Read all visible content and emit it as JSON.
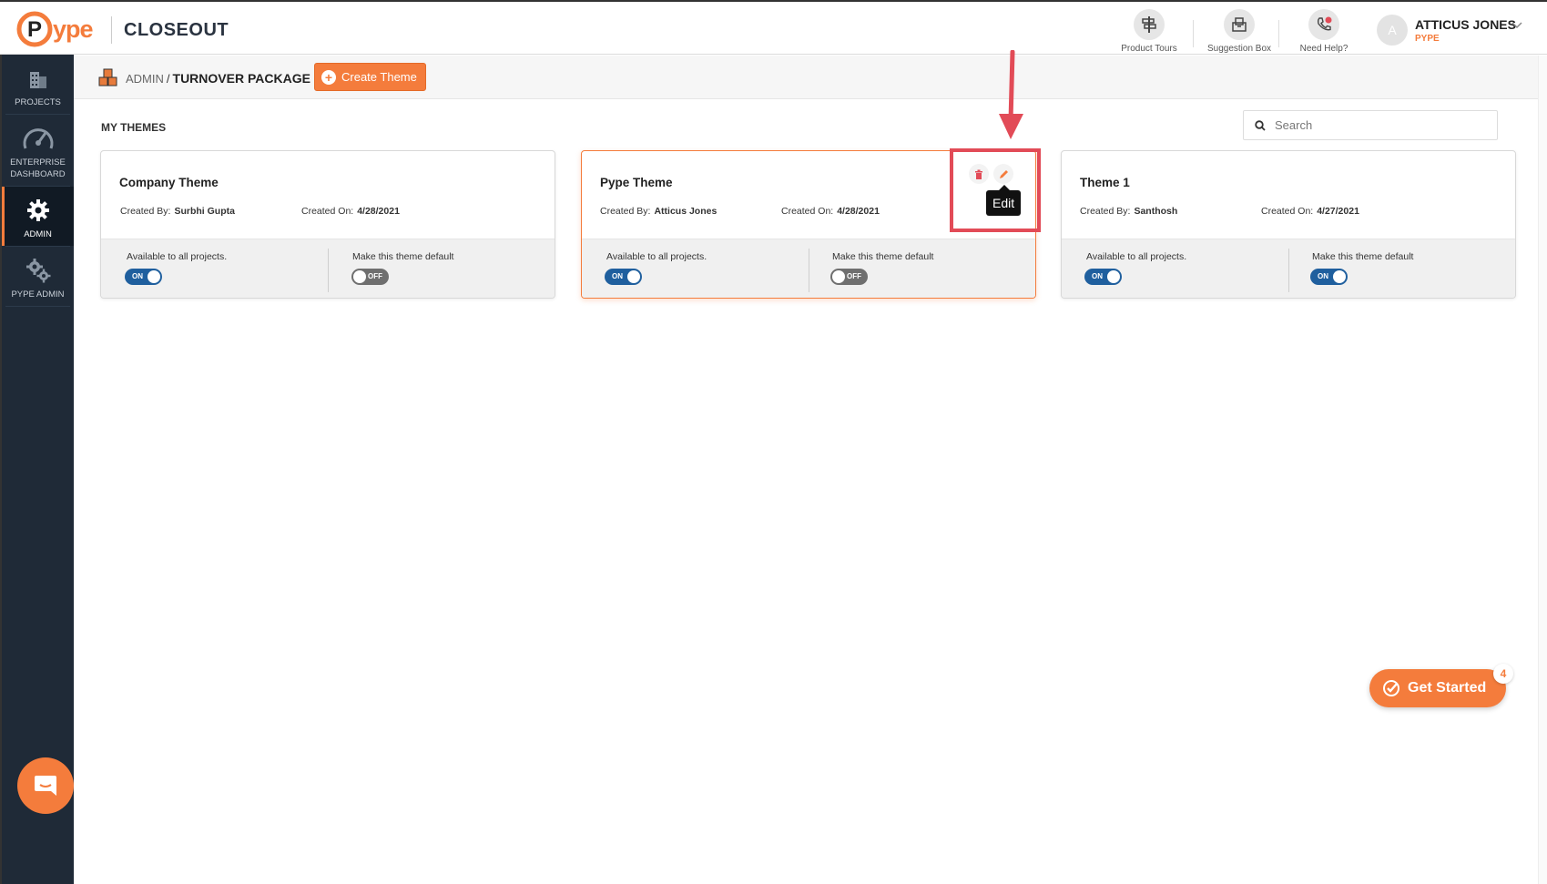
{
  "app": {
    "logo_text": "ype",
    "title": "CLOSEOUT"
  },
  "header": {
    "product_tours": "Product Tours",
    "suggestion_box": "Suggestion Box",
    "need_help": "Need Help?",
    "user_initial": "A",
    "user_name": "ATTICUS JONES",
    "user_org": "PYPE"
  },
  "sidebar": {
    "items": [
      {
        "label": "PROJECTS"
      },
      {
        "label": "ENTERPRISE DASHBOARD"
      },
      {
        "label": "ADMIN"
      },
      {
        "label": "PYPE ADMIN"
      }
    ]
  },
  "breadcrumb": {
    "parent": "ADMIN",
    "separator": "/",
    "current": "TURNOVER PACKAGE"
  },
  "toolbar": {
    "create_label": "Create Theme"
  },
  "themes_section": {
    "title": "MY THEMES"
  },
  "search": {
    "placeholder": "Search"
  },
  "theme_labels": {
    "created_by": "Created By:",
    "created_on": "Created On:",
    "available": "Available to all projects.",
    "default": "Make this theme default"
  },
  "themes": [
    {
      "name": "Company Theme",
      "created_by": "Surbhi Gupta",
      "created_on": "4/28/2021",
      "available": "ON",
      "default": "OFF"
    },
    {
      "name": "Pype Theme",
      "created_by": "Atticus Jones",
      "created_on": "4/28/2021",
      "available": "ON",
      "default": "OFF"
    },
    {
      "name": "Theme 1",
      "created_by": "Santhosh",
      "created_on": "4/27/2021",
      "available": "ON",
      "default": "ON"
    }
  ],
  "tooltip": {
    "edit": "Edit"
  },
  "get_started": {
    "label": "Get Started",
    "badge": "4"
  },
  "colors": {
    "accent": "#f47c3c",
    "sidebar": "#1f2a37",
    "toggle_on": "#1f5f9e",
    "annotation": "#e24b57"
  }
}
